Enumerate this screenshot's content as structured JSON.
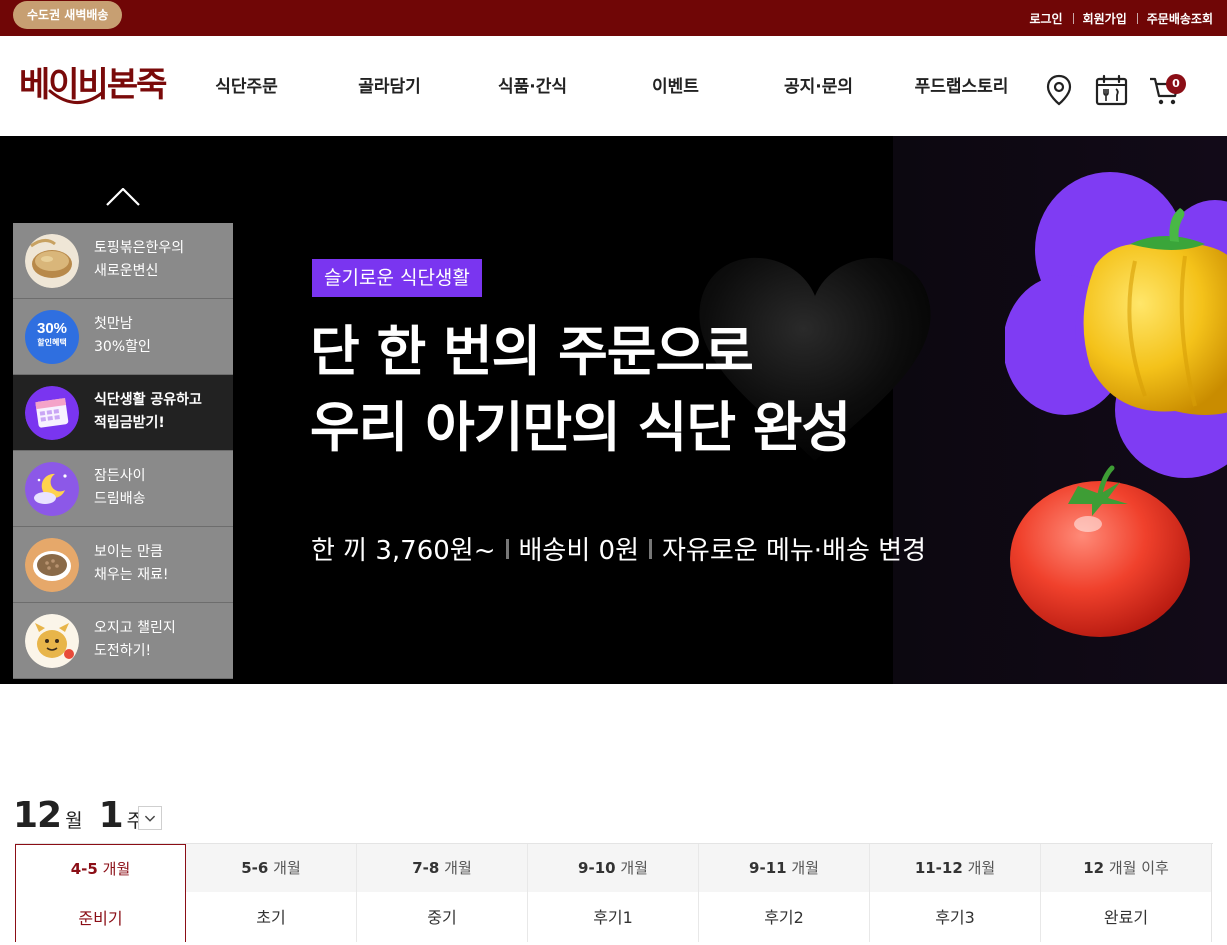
{
  "topbar": {
    "badge": "수도권 새벽배송",
    "links": [
      "로그인",
      "회원가입",
      "주문배송조회"
    ]
  },
  "header": {
    "logo_text": "베이비본죽",
    "nav": [
      "식단주문",
      "골라담기",
      "식품·간식",
      "이벤트",
      "공지·문의",
      "푸드랩스토리"
    ],
    "cart_count": "0"
  },
  "hero": {
    "tag": "슬기로운 식단생활",
    "title_line1": "단 한 번의 주문으로",
    "title_line2": "우리 아기만의 식단 완성",
    "sub": [
      "한 끼 3,760원~",
      "배송비 0원",
      "자유로운 메뉴·배송 변경"
    ],
    "side_items": [
      {
        "line1": "토핑볶은한우의",
        "line2": "새로운변신"
      },
      {
        "line1": "첫만남",
        "line2": "30%할인",
        "thumb_text1": "30%",
        "thumb_text2": "할인혜택"
      },
      {
        "line1": "식단생활 공유하고",
        "line2": "적립금받기!"
      },
      {
        "line1": "잠든사이",
        "line2": "드림배송"
      },
      {
        "line1": "보이는 만큼",
        "line2": "채우는 재료!"
      },
      {
        "line1": "오지고 챌린지",
        "line2": "도전하기!"
      }
    ]
  },
  "week": {
    "month": "12",
    "month_unit": "월",
    "week": "1",
    "week_unit": "주"
  },
  "tabs": [
    {
      "months": "4-5",
      "unit": "개월",
      "stage": "준비기"
    },
    {
      "months": "5-6",
      "unit": "개월",
      "stage": "초기"
    },
    {
      "months": "7-8",
      "unit": "개월",
      "stage": "중기"
    },
    {
      "months": "9-10",
      "unit": "개월",
      "stage": "후기1"
    },
    {
      "months": "9-11",
      "unit": "개월",
      "stage": "후기2"
    },
    {
      "months": "11-12",
      "unit": "개월",
      "stage": "후기3"
    },
    {
      "months": "12",
      "unit": "개월 이후",
      "stage": "완료기"
    }
  ],
  "colors": {
    "brand": "#700606",
    "accent": "#8b0e16",
    "tag_purple": "#7a35f0",
    "badge_gold": "#c79f72"
  }
}
